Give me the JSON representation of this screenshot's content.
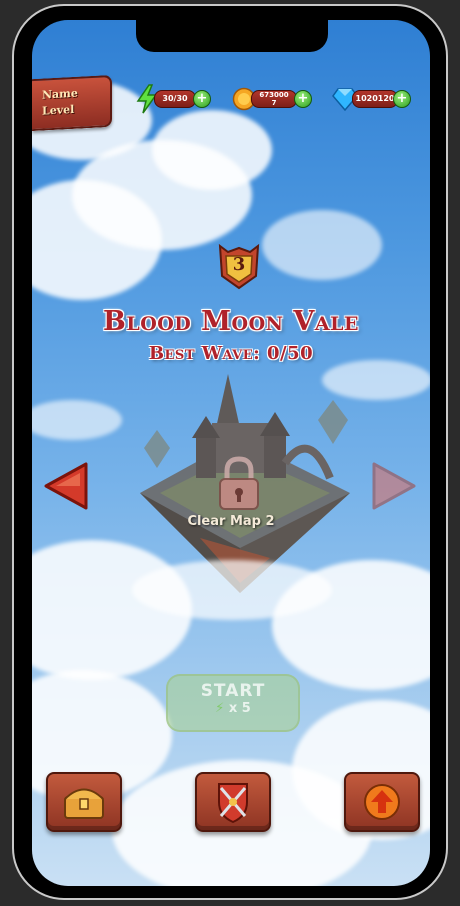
{
  "player": {
    "name_label": "Name",
    "level_label": "Level"
  },
  "resources": {
    "energy": {
      "value": "30/30",
      "icon": "lightning-icon"
    },
    "coins": {
      "value_line1": "673000",
      "value_line2": "7",
      "icon": "coin-icon"
    },
    "gems": {
      "value": "1020120",
      "icon": "gem-icon"
    }
  },
  "map": {
    "level_number": "3",
    "name": "Blood Moon Vale",
    "best_wave": "Best Wave: 0/50",
    "lock_text": "Clear Map 2",
    "locked": true
  },
  "start": {
    "label": "START",
    "cost": "x 5",
    "enabled": false
  },
  "bottom_nav": [
    {
      "name": "inventory-chest-button",
      "icon": "chest-icon"
    },
    {
      "name": "battle-button",
      "icon": "crossed-swords-shield-icon"
    },
    {
      "name": "upgrade-button",
      "icon": "up-arrow-icon"
    }
  ],
  "colors": {
    "title_red": "#b0222a",
    "wood": "#a5442e",
    "sky": "#4c97df"
  }
}
